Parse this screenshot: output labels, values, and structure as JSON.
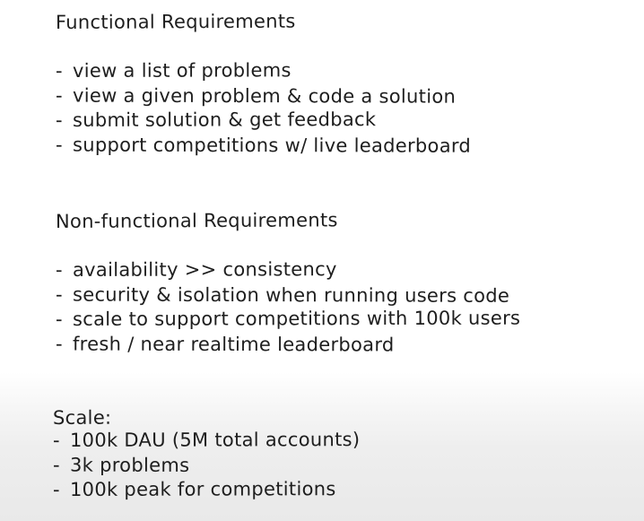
{
  "functional": {
    "title": "Functional Requirements",
    "items": [
      "view a list of problems",
      "view a given problem & code a solution",
      "submit solution & get feedback",
      "support competitions w/ live leaderboard"
    ]
  },
  "nonfunctional": {
    "title": "Non-functional Requirements",
    "items": [
      "availability >> consistency",
      "security & isolation when running users code",
      "scale to support competitions with 100k users",
      "fresh / near realtime leaderboard"
    ]
  },
  "scale": {
    "title": "Scale:",
    "items": [
      "100k DAU (5M total accounts)",
      "3k problems",
      "100k peak for competitions"
    ]
  },
  "bullet": "-"
}
